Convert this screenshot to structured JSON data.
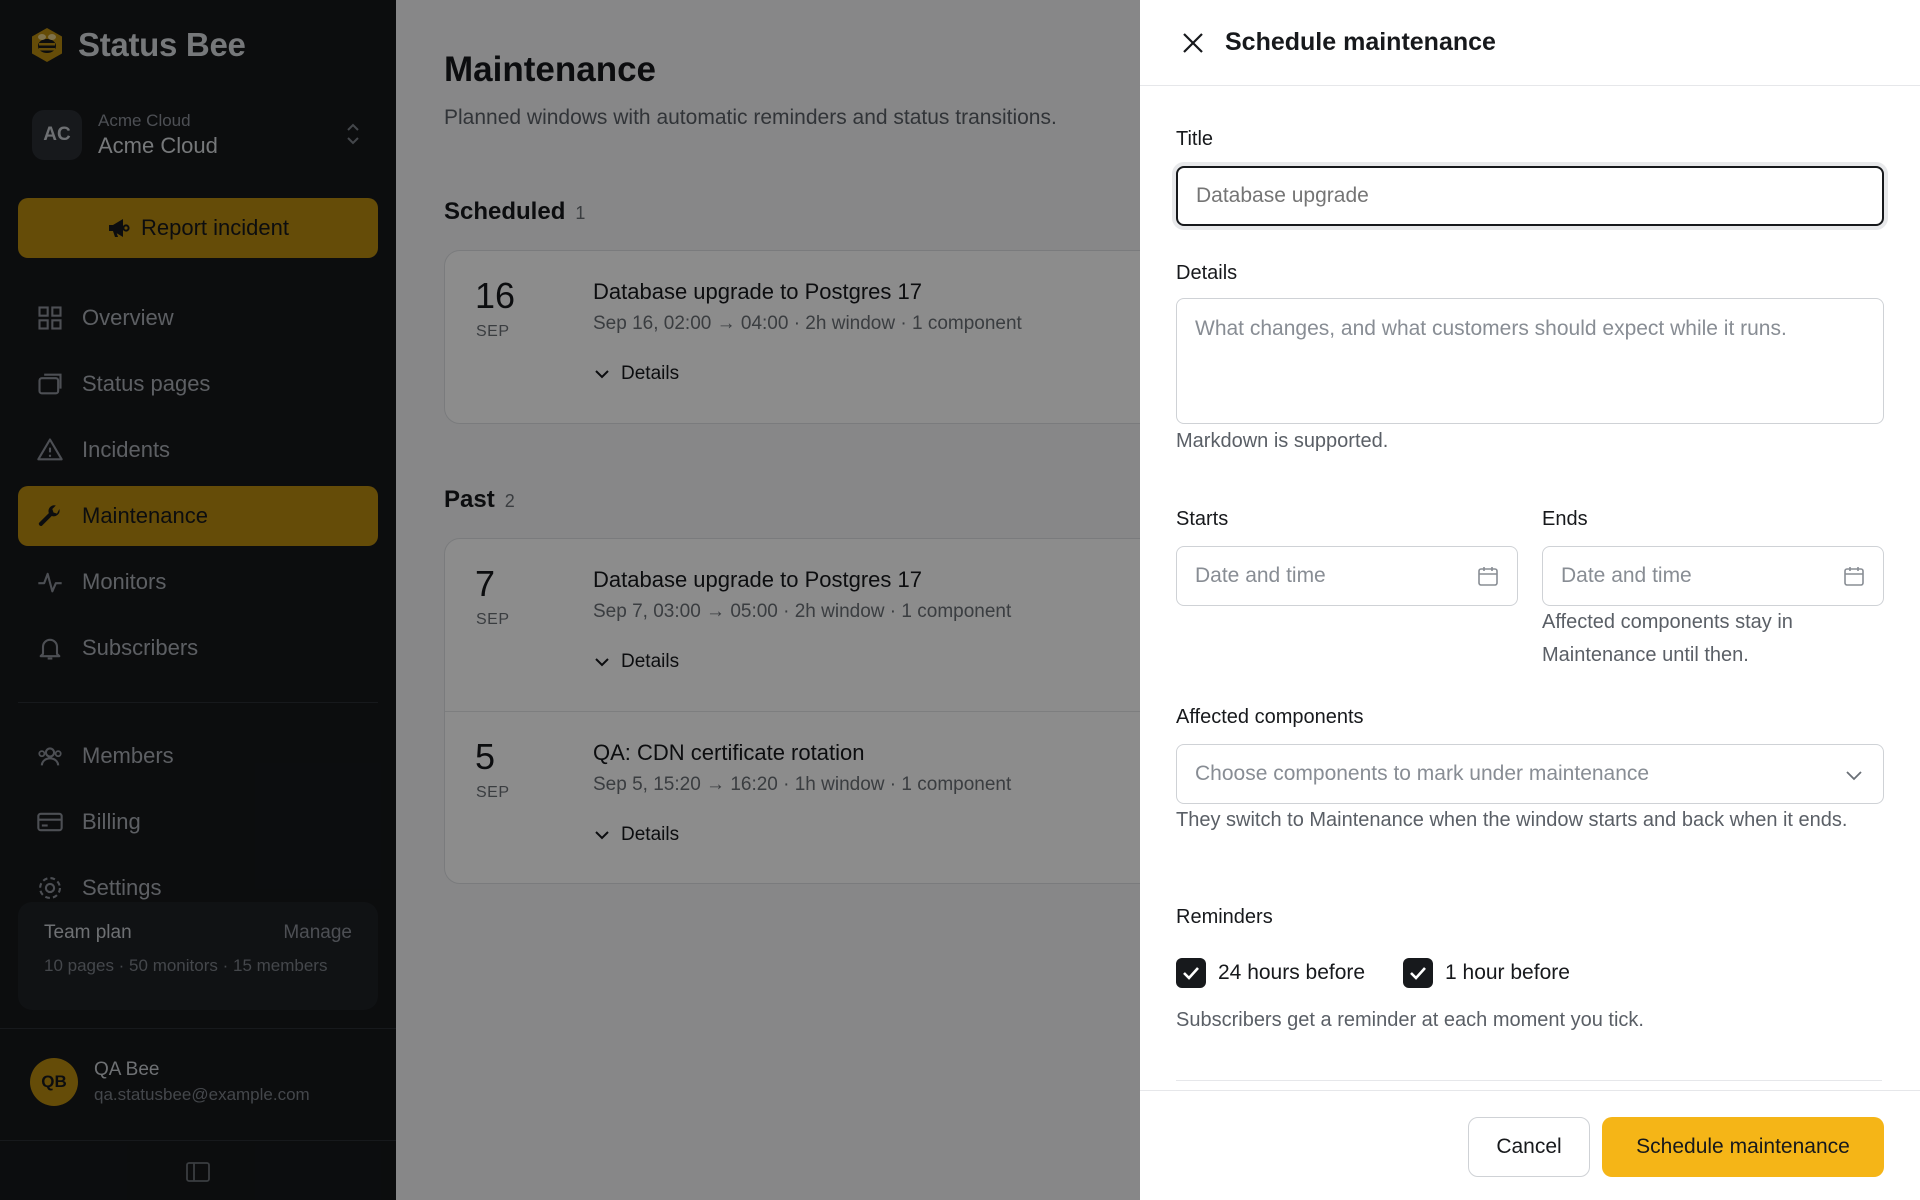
{
  "brand": {
    "name": "Status Bee"
  },
  "org": {
    "initials": "AC",
    "sub": "Acme Cloud",
    "name": "Acme Cloud"
  },
  "sidebar": {
    "report_label": "Report incident",
    "items": [
      {
        "label": "Overview",
        "icon": "grid-icon"
      },
      {
        "label": "Status pages",
        "icon": "pages-icon"
      },
      {
        "label": "Incidents",
        "icon": "warning-icon"
      },
      {
        "label": "Maintenance",
        "icon": "wrench-icon",
        "active": true
      },
      {
        "label": "Monitors",
        "icon": "pulse-icon"
      },
      {
        "label": "Subscribers",
        "icon": "bell-icon"
      }
    ],
    "items2": [
      {
        "label": "Members",
        "icon": "users-icon"
      },
      {
        "label": "Billing",
        "icon": "card-icon"
      },
      {
        "label": "Settings",
        "icon": "gear-icon"
      }
    ],
    "plan": {
      "name": "Team plan",
      "manage": "Manage",
      "meta": "10 pages · 50 monitors · 15 members"
    },
    "user": {
      "initials": "QB",
      "name": "QA Bee",
      "email": "qa.statusbee@example.com"
    }
  },
  "main": {
    "title": "Maintenance",
    "subtitle": "Planned windows with automatic reminders and status transitions.",
    "scheduled": {
      "label": "Scheduled",
      "count": "1",
      "rows": [
        {
          "day": "16",
          "month": "SEP",
          "title": "Database upgrade to Postgres 17",
          "meta": "Sep 16, 02:00 → 04:00  ·  2h window  ·  1 component",
          "details": "Details"
        }
      ]
    },
    "past": {
      "label": "Past",
      "count": "2",
      "rows": [
        {
          "day": "7",
          "month": "SEP",
          "title": "Database upgrade to Postgres 17",
          "meta": "Sep 7, 03:00 → 05:00  ·  2h window  ·  1 component",
          "details": "Details"
        },
        {
          "day": "5",
          "month": "SEP",
          "title": "QA: CDN certificate rotation",
          "meta": "Sep 5, 15:20 → 16:20  ·  1h window  ·  1 component",
          "details": "Details"
        }
      ]
    }
  },
  "drawer": {
    "title": "Schedule maintenance",
    "title_label": "Title",
    "title_placeholder": "Database upgrade",
    "details_label": "Details",
    "details_placeholder": "What changes, and what customers should expect while it runs.",
    "details_help": "Markdown is supported.",
    "starts_label": "Starts",
    "starts_placeholder": "Date and time",
    "ends_label": "Ends",
    "ends_placeholder": "Date and time",
    "ends_help": "Affected components stay in Maintenance until then.",
    "components_label": "Affected components",
    "components_placeholder": "Choose components to mark under maintenance",
    "components_help": "They switch to Maintenance when the window starts and back when it ends.",
    "reminders_label": "Reminders",
    "reminder_24h": "24 hours before",
    "reminder_1h": "1 hour before",
    "reminders_help": "Subscribers get a reminder at each moment you tick.",
    "cancel_label": "Cancel",
    "submit_label": "Schedule maintenance"
  },
  "colors": {
    "accent": "#f5b517",
    "accent_dim": "#b88a10",
    "sidebar_bg": "#16181b"
  }
}
